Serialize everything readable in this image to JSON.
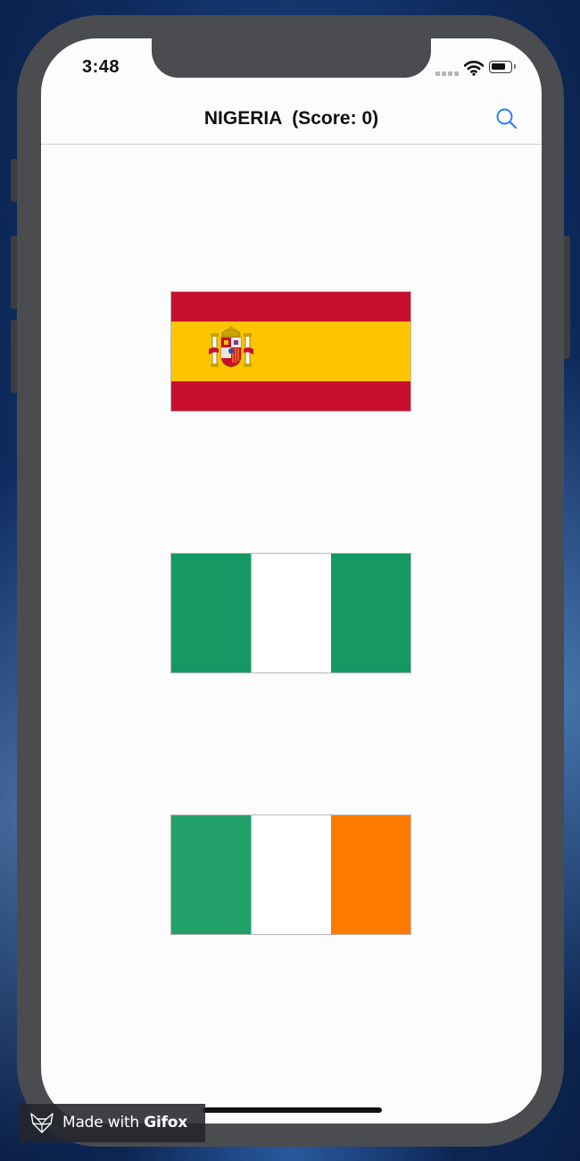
{
  "status_bar": {
    "time": "3:48"
  },
  "nav": {
    "title": "NIGERIA  (Score: 0)",
    "search_icon": "magnifier-icon"
  },
  "flags": [
    {
      "country_icon": "spain-flag",
      "colors": [
        "#c8102e",
        "#fcc500",
        "#c8102e"
      ]
    },
    {
      "country_icon": "nigeria-flag",
      "colors": [
        "#159863",
        "#ffffff",
        "#159863"
      ]
    },
    {
      "country_icon": "ireland-flag",
      "colors": [
        "#22a06a",
        "#ffffff",
        "#ff7a00"
      ]
    }
  ],
  "watermark": {
    "prefix": "Made with ",
    "brand": "Gifox"
  },
  "colors": {
    "accent": "#2f80ed",
    "phone_frame": "#4a4c4f",
    "screen_bg": "#fcfcfc"
  }
}
